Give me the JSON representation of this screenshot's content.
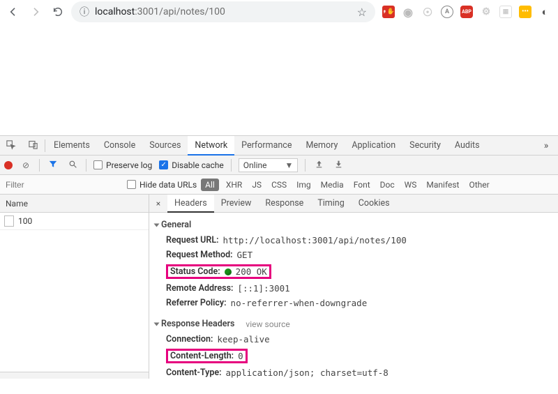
{
  "address": {
    "host": "localhost",
    "rest": ":3001/api/notes/100"
  },
  "devtools_tabs": [
    "Elements",
    "Console",
    "Sources",
    "Network",
    "Performance",
    "Memory",
    "Application",
    "Security",
    "Audits"
  ],
  "devtools_active_tab": "Network",
  "toolbar": {
    "preserve_log": "Preserve log",
    "disable_cache": "Disable cache",
    "online": "Online"
  },
  "filter": {
    "placeholder": "Filter",
    "hide_data_urls": "Hide data URLs",
    "types": [
      "All",
      "XHR",
      "JS",
      "CSS",
      "Img",
      "Media",
      "Font",
      "Doc",
      "WS",
      "Manifest",
      "Other"
    ]
  },
  "names": {
    "header": "Name",
    "items": [
      "100"
    ]
  },
  "detail_tabs": [
    "Headers",
    "Preview",
    "Response",
    "Timing",
    "Cookies"
  ],
  "general": {
    "title": "General",
    "request_url_k": "Request URL:",
    "request_url_v": "http://localhost:3001/api/notes/100",
    "request_method_k": "Request Method:",
    "request_method_v": "GET",
    "status_code_k": "Status Code:",
    "status_code_v": "200 OK",
    "remote_addr_k": "Remote Address:",
    "remote_addr_v": "[::1]:3001",
    "referrer_k": "Referrer Policy:",
    "referrer_v": "no-referrer-when-downgrade"
  },
  "response_headers": {
    "title": "Response Headers",
    "view_source": "view source",
    "connection_k": "Connection:",
    "connection_v": "keep-alive",
    "content_length_k": "Content-Length:",
    "content_length_v": "0",
    "content_type_k": "Content-Type:",
    "content_type_v": "application/json; charset=utf-8"
  }
}
